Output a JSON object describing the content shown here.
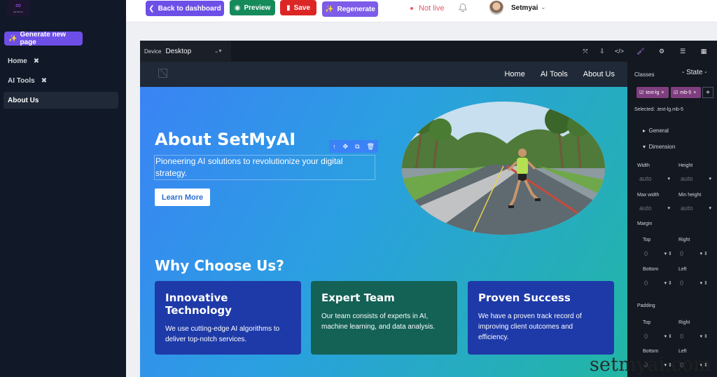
{
  "sidebar": {
    "logo_text": "SETMYAI",
    "generate_label": "Generate new page",
    "pages": [
      {
        "label": "Home",
        "active": false
      },
      {
        "label": "AI Tools",
        "active": false
      },
      {
        "label": "About Us",
        "active": true
      }
    ]
  },
  "topbar": {
    "back_label": "Back to dashboard",
    "preview_label": "Preview",
    "save_label": "Save",
    "regenerate_label": "Regenerate",
    "status_label": "Not live",
    "user_name": "Setmyai",
    "colors": {
      "back": "#6d4fe8",
      "preview": "#158a5a",
      "save": "#dc2626",
      "regenerate": "#7c5ce8",
      "status": "#e45b66"
    }
  },
  "editor": {
    "device_label": "Device",
    "device_value": "Desktop",
    "tools": [
      "fullscreen-icon",
      "import-icon",
      "code-icon"
    ],
    "panel_tabs": [
      "brush-icon",
      "gear-icon",
      "layers-icon",
      "blocks-icon"
    ]
  },
  "site": {
    "nav_links": [
      "Home",
      "AI Tools",
      "About Us"
    ],
    "hero_title": "About SetMyAI",
    "hero_subtitle": "Pioneering AI solutions to revolutionize your digital strategy.",
    "learn_more": "Learn More",
    "why_title": "Why Choose Us?",
    "cards": [
      {
        "title": "Innovative Technology",
        "text": "We use cutting-edge AI algorithms to deliver top-notch services.",
        "color": "#1e3aa8"
      },
      {
        "title": "Expert Team",
        "text": "Our team consists of experts in AI, machine learning, and data analysis.",
        "color": "#146156"
      },
      {
        "title": "Proven Success",
        "text": "We have a proven track record of improving client outcomes and efficiency.",
        "color": "#1e3aa8"
      }
    ]
  },
  "style_panel": {
    "classes_label": "Classes",
    "state_label": "- State -",
    "tags": [
      "text-lg",
      "mb-5"
    ],
    "selected_label": "Selected:",
    "selected_value": ".text-lg.mb-5",
    "general_label": "General",
    "dimension_label": "Dimension",
    "width_label": "Width",
    "height_label": "Height",
    "maxwidth_label": "Max width",
    "minheight_label": "Min height",
    "auto": "auto",
    "margin_label": "Margin",
    "padding_label": "Padding",
    "top_label": "Top",
    "right_label": "Right",
    "bottom_label": "Bottom",
    "left_label": "Left",
    "zero": "0"
  },
  "watermark": "setmyai.com"
}
